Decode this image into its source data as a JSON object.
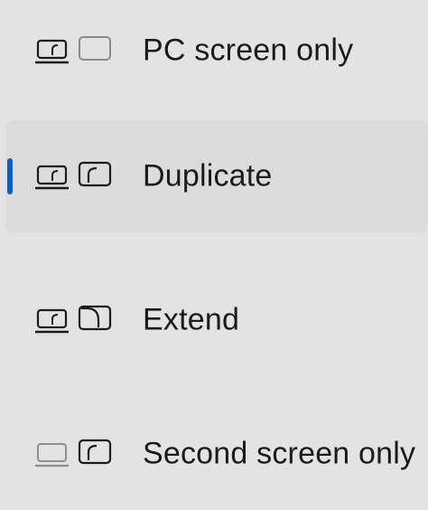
{
  "project_menu": {
    "accent_color": "#0a5fc6",
    "selected_index": 1,
    "items": [
      {
        "label": "PC screen only",
        "icon": "pc-screen-only-icon"
      },
      {
        "label": "Duplicate",
        "icon": "duplicate-icon"
      },
      {
        "label": "Extend",
        "icon": "extend-icon"
      },
      {
        "label": "Second screen only",
        "icon": "second-screen-only-icon"
      }
    ]
  }
}
